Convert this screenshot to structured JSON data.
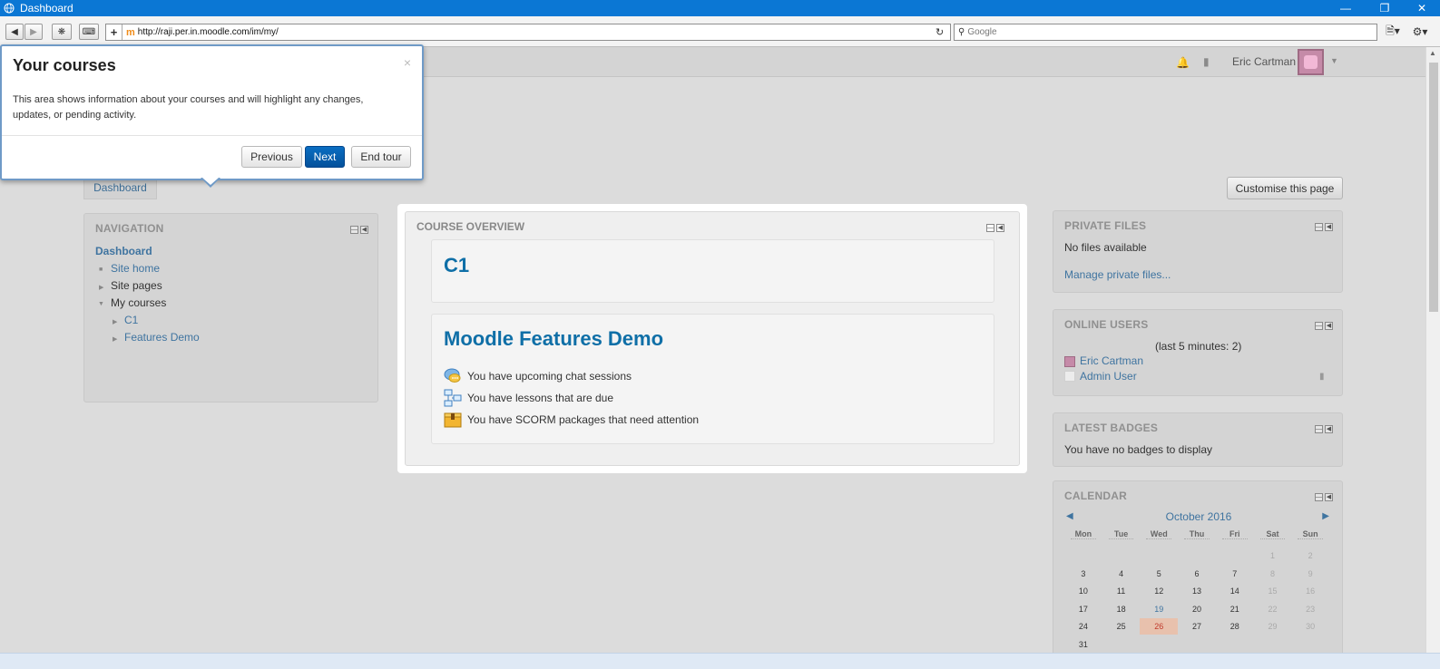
{
  "window": {
    "title": "Dashboard"
  },
  "browser": {
    "url": "http://raji.per.in.moodle.com/im/my/",
    "search_placeholder": "Google"
  },
  "navbar": {
    "user_name": "Eric Cartman"
  },
  "breadcrumb": {
    "dashboard": "Dashboard"
  },
  "customise_button": "Customise this page",
  "navigation_block": {
    "title": "NAVIGATION",
    "dashboard": "Dashboard",
    "items": [
      {
        "label": "Site home"
      },
      {
        "label": "Site pages"
      },
      {
        "label": "My courses"
      },
      {
        "label": "C1"
      },
      {
        "label": "Features Demo"
      }
    ]
  },
  "course_overview": {
    "title": "COURSE OVERVIEW",
    "courses": [
      {
        "name": "C1"
      },
      {
        "name": "Moodle Features Demo",
        "activities": [
          {
            "icon": "chat-icon",
            "text": "You have upcoming chat sessions"
          },
          {
            "icon": "lesson-icon",
            "text": "You have lessons that are due"
          },
          {
            "icon": "scorm-icon",
            "text": "You have SCORM packages that need attention"
          }
        ]
      }
    ]
  },
  "private_files": {
    "title": "PRIVATE FILES",
    "status": "No files available",
    "manage_link": "Manage private files..."
  },
  "online_users": {
    "title": "ONLINE USERS",
    "subtitle": "(last 5 minutes: 2)",
    "users": [
      {
        "name": "Eric Cartman"
      },
      {
        "name": "Admin User"
      }
    ]
  },
  "latest_badges": {
    "title": "LATEST BADGES",
    "status": "You have no badges to display"
  },
  "calendar": {
    "title": "CALENDAR",
    "month": "October 2016",
    "days": [
      "Mon",
      "Tue",
      "Wed",
      "Thu",
      "Fri",
      "Sat",
      "Sun"
    ],
    "weeks": [
      [
        "",
        "",
        "",
        "",
        "",
        "1",
        "2"
      ],
      [
        "3",
        "4",
        "5",
        "6",
        "7",
        "8",
        "9"
      ],
      [
        "10",
        "11",
        "12",
        "13",
        "14",
        "15",
        "16"
      ],
      [
        "17",
        "18",
        "19",
        "20",
        "21",
        "22",
        "23"
      ],
      [
        "24",
        "25",
        "26",
        "27",
        "28",
        "29",
        "30"
      ],
      [
        "31",
        "",
        "",
        "",
        "",
        "",
        ""
      ]
    ],
    "event_day": "19",
    "today": "26"
  },
  "tour": {
    "title": "Your courses",
    "body": "This area shows information about your courses and will highlight any changes, updates, or pending activity.",
    "previous": "Previous",
    "next": "Next",
    "end": "End tour",
    "close": "×"
  },
  "colors": {
    "link": "#3f74a0",
    "course_title": "#0f6fa7",
    "primary_button": "#0a5fb0",
    "today_highlight": "#e8c1ad"
  }
}
